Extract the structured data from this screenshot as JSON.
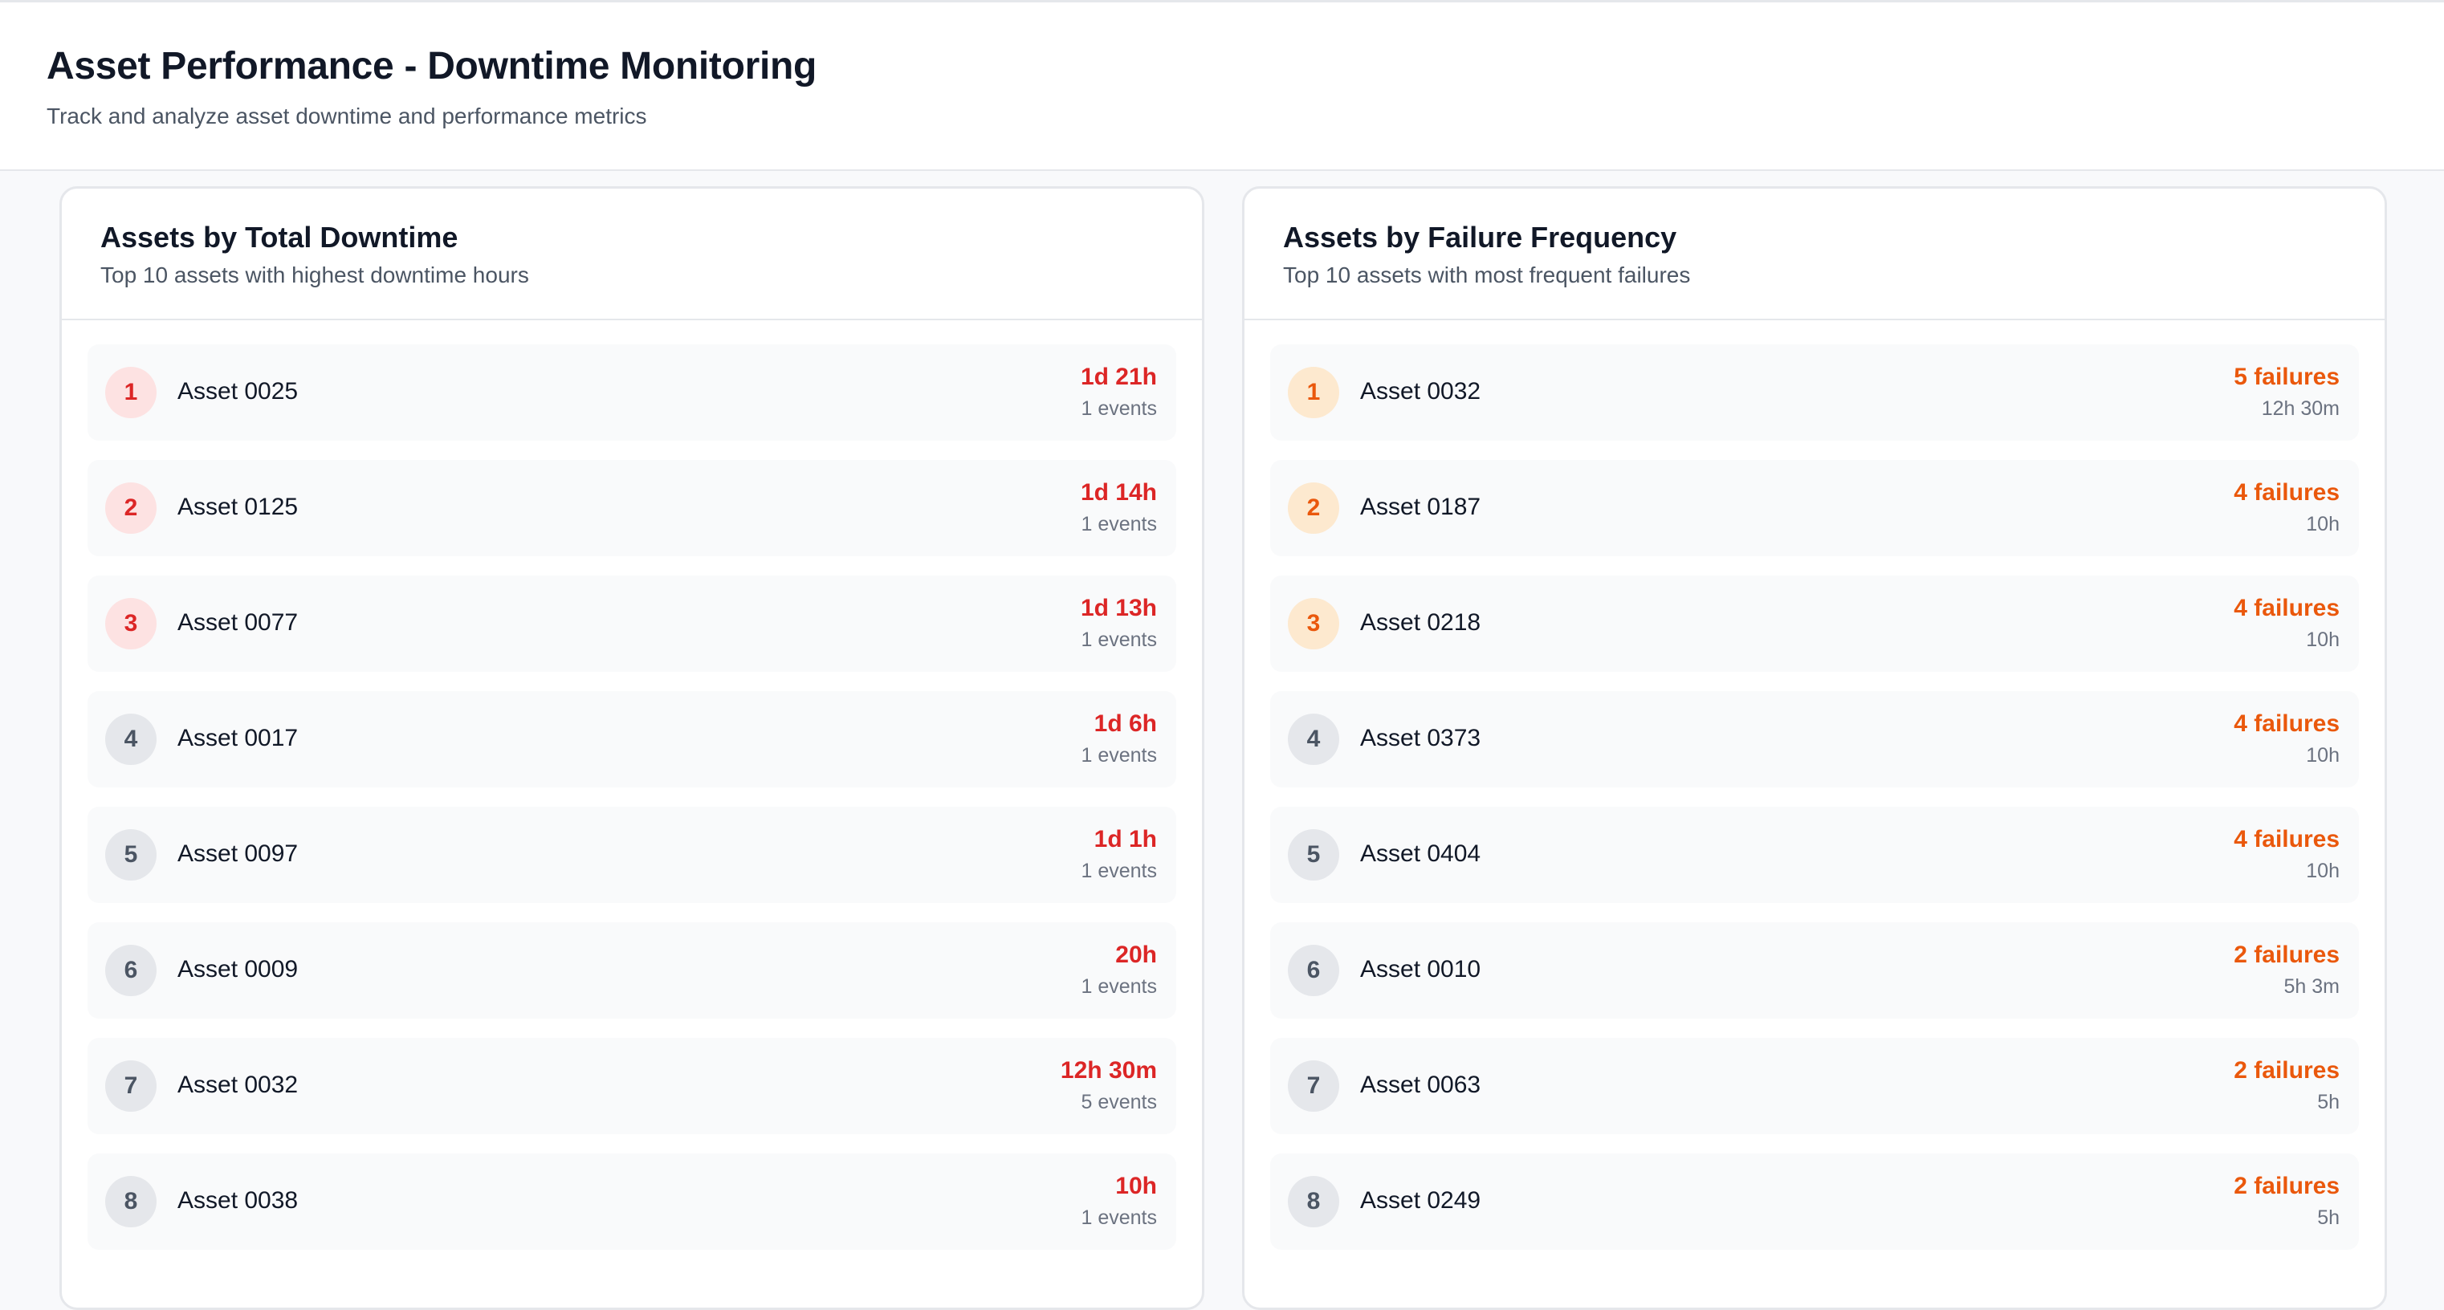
{
  "header": {
    "title": "Asset Performance - Downtime Monitoring",
    "subtitle": "Track and analyze asset downtime and performance metrics"
  },
  "downtime_card": {
    "title": "Assets by Total Downtime",
    "subtitle": "Top 10 assets with highest downtime hours",
    "accent_color": "#dc2626",
    "items": [
      {
        "rank": "1",
        "name": "Asset 0025",
        "value": "1d 21h",
        "detail": "1 events"
      },
      {
        "rank": "2",
        "name": "Asset 0125",
        "value": "1d 14h",
        "detail": "1 events"
      },
      {
        "rank": "3",
        "name": "Asset 0077",
        "value": "1d 13h",
        "detail": "1 events"
      },
      {
        "rank": "4",
        "name": "Asset 0017",
        "value": "1d 6h",
        "detail": "1 events"
      },
      {
        "rank": "5",
        "name": "Asset 0097",
        "value": "1d 1h",
        "detail": "1 events"
      },
      {
        "rank": "6",
        "name": "Asset 0009",
        "value": "20h",
        "detail": "1 events"
      },
      {
        "rank": "7",
        "name": "Asset 0032",
        "value": "12h 30m",
        "detail": "5 events"
      },
      {
        "rank": "8",
        "name": "Asset 0038",
        "value": "10h",
        "detail": "1 events"
      }
    ]
  },
  "frequency_card": {
    "title": "Assets by Failure Frequency",
    "subtitle": "Top 10 assets with most frequent failures",
    "accent_color": "#ea580c",
    "items": [
      {
        "rank": "1",
        "name": "Asset 0032",
        "value": "5 failures",
        "detail": "12h 30m"
      },
      {
        "rank": "2",
        "name": "Asset 0187",
        "value": "4 failures",
        "detail": "10h"
      },
      {
        "rank": "3",
        "name": "Asset 0218",
        "value": "4 failures",
        "detail": "10h"
      },
      {
        "rank": "4",
        "name": "Asset 0373",
        "value": "4 failures",
        "detail": "10h"
      },
      {
        "rank": "5",
        "name": "Asset 0404",
        "value": "4 failures",
        "detail": "10h"
      },
      {
        "rank": "6",
        "name": "Asset 0010",
        "value": "2 failures",
        "detail": "5h 3m"
      },
      {
        "rank": "7",
        "name": "Asset 0063",
        "value": "2 failures",
        "detail": "5h"
      },
      {
        "rank": "8",
        "name": "Asset 0249",
        "value": "2 failures",
        "detail": "5h"
      }
    ]
  }
}
